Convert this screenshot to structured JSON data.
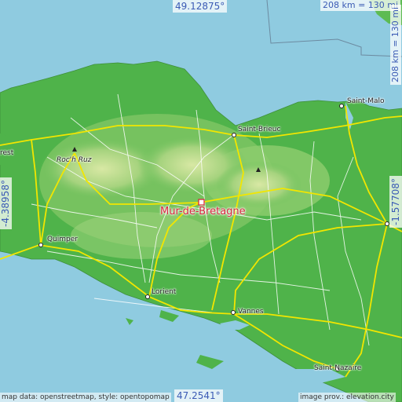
{
  "place": {
    "name": "Mur-de-Bretagne",
    "color": "#d7263d"
  },
  "coords": {
    "north": "49.12875°",
    "south": "47.2541°",
    "west": "-4.38958°",
    "east": "-1.57708°"
  },
  "scale": {
    "horizontal": "208 km = 130 mi",
    "vertical": "208 km = 130 mi"
  },
  "cities": {
    "saint_malo": "Saint-Malo",
    "saint_brieuc": "Saint-Brieuc",
    "brest": "rest",
    "roch_ruz": "Roc'h Ruz",
    "quimper": "Quimper",
    "lorient": "Lorient",
    "vannes": "Vannes",
    "saint_nazaire": "Saint-Nazaire"
  },
  "credits": {
    "left": "map data: openstreetmap, style: opentopomap",
    "right": "image prov.: elevation.city"
  },
  "colors": {
    "sea": "#8fcbe0",
    "lowland": "#4fb34a",
    "midland": "#86c96a",
    "highland": "#cde39a",
    "road_major": "#f2e600",
    "road_minor": "#ffffff"
  }
}
